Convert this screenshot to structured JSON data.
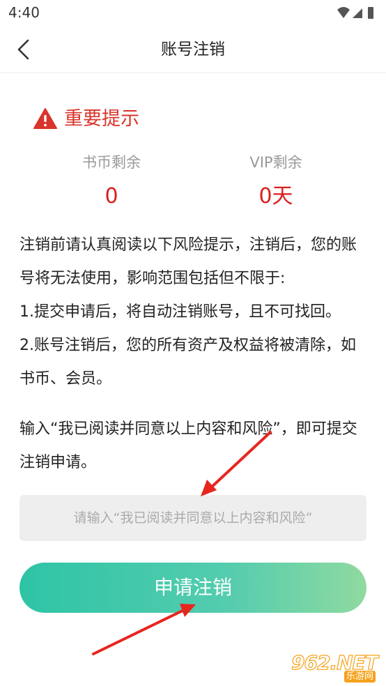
{
  "status_bar": {
    "time": "4:40",
    "icons": [
      "wifi-icon",
      "signal-icon",
      "battery-icon"
    ]
  },
  "nav": {
    "title": "账号注销",
    "back_icon": "chevron-left-icon"
  },
  "warning": {
    "icon": "warning-triangle-icon",
    "text": "重要提示"
  },
  "stats": [
    {
      "label": "书币剩余",
      "value": "0"
    },
    {
      "label": "VIP剩余",
      "value": "0天"
    }
  ],
  "notice": [
    "注销前请认真阅读以下风险提示，注销后，您的账号将无法使用，影响范围包括但不限于:",
    "1.提交申请后，将自动注销账号，且不可找回。",
    "2.账号注销后，您的所有资产及权益将被清除，如书币、会员。"
  ],
  "hint": "输入“我已阅读并同意以上内容和风险”，即可提交注销申请。",
  "input": {
    "placeholder": "请输入“我已阅读并同意以上内容和风险”",
    "value": ""
  },
  "submit_label": "申请注销",
  "watermark": {
    "main": "962.NET",
    "sub": "乐游网"
  },
  "colors": {
    "accent_red": "#d91f1f",
    "button_start": "#2ec4a6",
    "button_end": "#8fdaa0",
    "annotation": "#e8251e"
  }
}
